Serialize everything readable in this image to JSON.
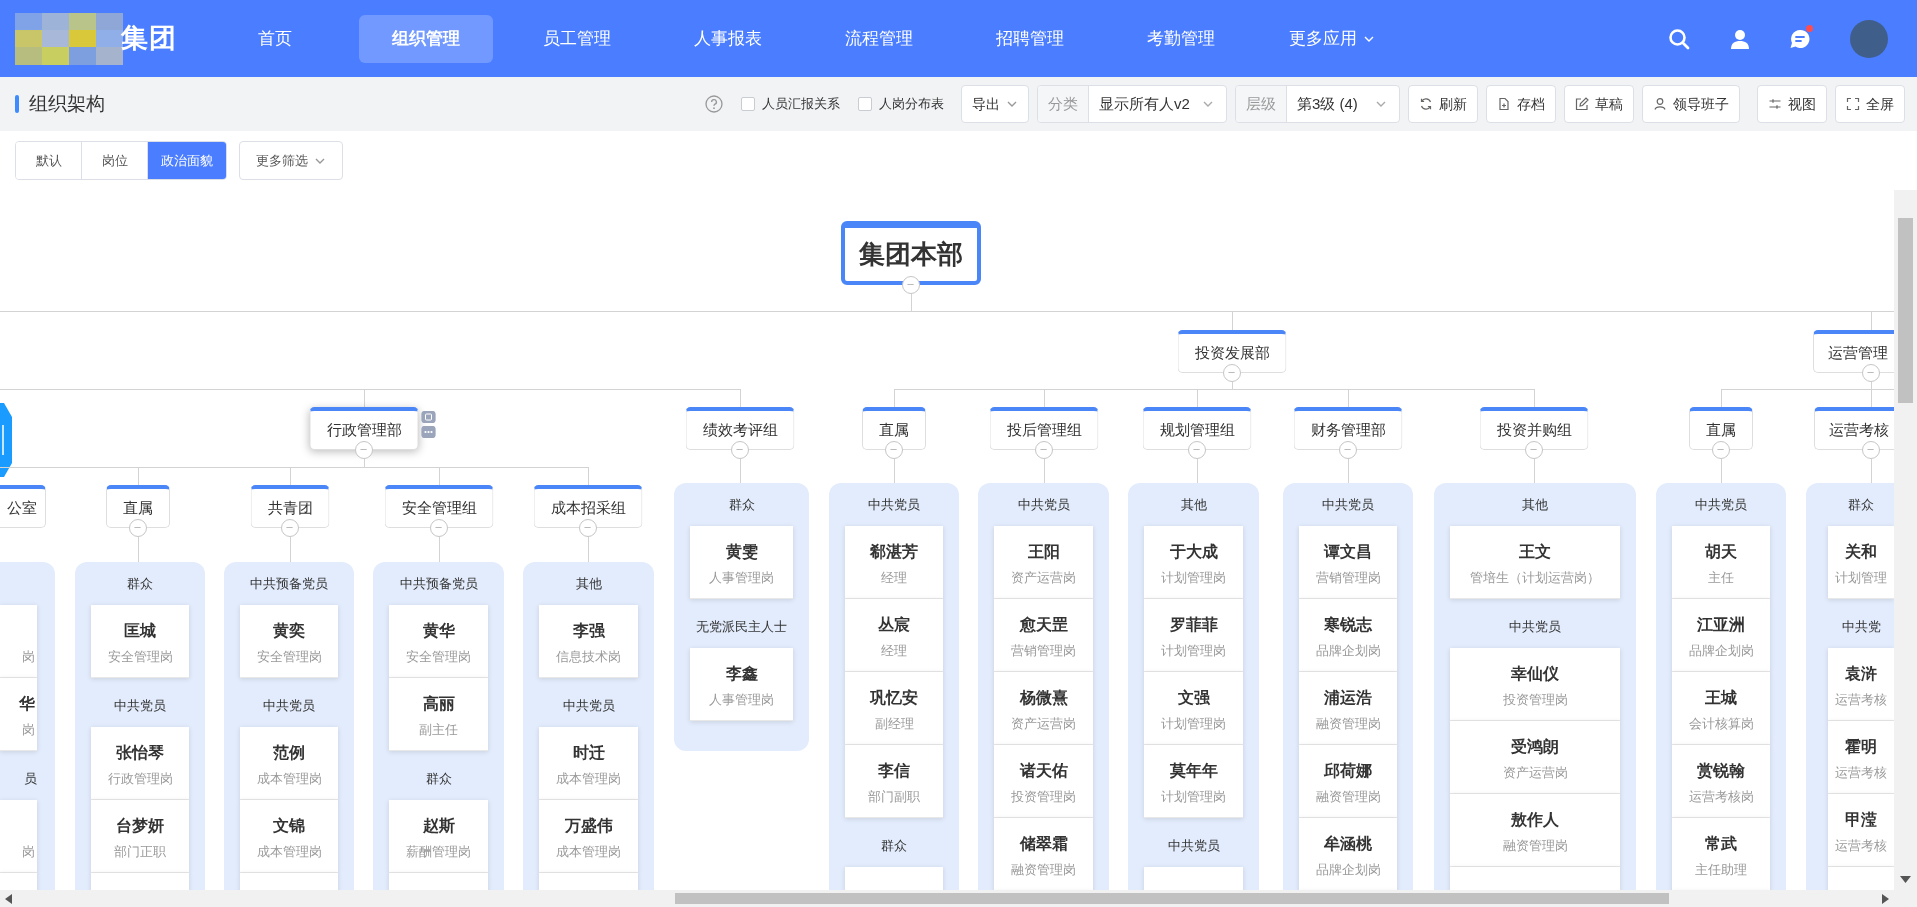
{
  "nav": {
    "brand": "集团",
    "items": [
      {
        "label": "首页",
        "selected": false
      },
      {
        "label": "组织管理",
        "selected": true
      },
      {
        "label": "员工管理",
        "selected": false
      },
      {
        "label": "人事报表",
        "selected": false
      },
      {
        "label": "流程管理",
        "selected": false
      },
      {
        "label": "招聘管理",
        "selected": false
      },
      {
        "label": "考勤管理",
        "selected": false
      }
    ],
    "more": "更多应用",
    "unread": true
  },
  "toolbar": {
    "title": "组织架构",
    "checkboxes": [
      {
        "label": "人员汇报关系",
        "checked": false
      },
      {
        "label": "人岗分布表",
        "checked": false
      }
    ],
    "export": "导出",
    "selects": [
      {
        "label": "分类",
        "value": "显示所有人v2"
      },
      {
        "label": "层级",
        "value": "第3级 (4)"
      }
    ],
    "buttons": [
      "刷新",
      "存档",
      "草稿",
      "领导班子",
      "视图",
      "全屏"
    ]
  },
  "filters": {
    "tabs": [
      {
        "label": "默认",
        "selected": false
      },
      {
        "label": "岗位",
        "selected": false
      },
      {
        "label": "政治面貌",
        "selected": true
      }
    ],
    "more": "更多筛选"
  },
  "chart": {
    "root": {
      "name": "集团本部"
    },
    "branches": [
      {
        "children": [
          {
            "name": "行政管理部",
            "selected": true,
            "children": [
              {
                "name": "公室",
                "selected": false,
                "panel": {
                  "cut_off": true,
                  "groups": [
                    {
                      "members": [
                        {
                          "role": "岗"
                        },
                        {
                          "name": "华",
                          "role": "岗"
                        }
                      ]
                    },
                    {
                      "label": "员",
                      "members": [
                        {
                          "role": "岗"
                        }
                      ]
                    }
                  ]
                }
              },
              {
                "name": "直属",
                "selected": false,
                "panel": {
                  "cut_off": true,
                  "groups": [
                    {
                      "label": "群众",
                      "members": [
                        {
                          "name": "匡城",
                          "role": "安全管理岗"
                        }
                      ]
                    },
                    {
                      "label": "中共党员",
                      "members": [
                        {
                          "name": "张怡琴",
                          "role": "行政管理岗"
                        },
                        {
                          "name": "台梦妍",
                          "role": "部门正职"
                        }
                      ]
                    }
                  ]
                }
              },
              {
                "name": "共青团",
                "selected": false,
                "panel": {
                  "cut_off": true,
                  "groups": [
                    {
                      "label": "中共预备党员",
                      "members": [
                        {
                          "name": "黄奕",
                          "role": "安全管理岗"
                        }
                      ]
                    },
                    {
                      "label": "中共党员",
                      "members": [
                        {
                          "name": "范例",
                          "role": "成本管理岗"
                        },
                        {
                          "name": "文锦",
                          "role": "成本管理岗"
                        }
                      ]
                    }
                  ]
                }
              },
              {
                "name": "安全管理组",
                "selected": false,
                "panel": {
                  "cut_off": true,
                  "groups": [
                    {
                      "label": "中共预备党员",
                      "members": [
                        {
                          "name": "黄华",
                          "role": "安全管理岗"
                        },
                        {
                          "name": "高丽",
                          "role": "副主任"
                        }
                      ]
                    },
                    {
                      "label": "群众",
                      "members": [
                        {
                          "name": "赵斯",
                          "role": "薪酬管理岗"
                        }
                      ]
                    }
                  ]
                }
              },
              {
                "name": "成本招采组",
                "selected": false,
                "panel": {
                  "cut_off": true,
                  "groups": [
                    {
                      "label": "其他",
                      "members": [
                        {
                          "name": "李强",
                          "role": "信息技术岗"
                        }
                      ]
                    },
                    {
                      "label": "中共党员",
                      "members": [
                        {
                          "name": "时迁",
                          "role": "成本管理岗"
                        },
                        {
                          "name": "万盛伟",
                          "role": "成本管理岗"
                        }
                      ]
                    }
                  ]
                }
              }
            ]
          },
          {
            "name": "绩效考评组",
            "selected": false,
            "panel": {
              "groups": [
                {
                  "label": "群众",
                  "members": [
                    {
                      "name": "黄雯",
                      "role": "人事管理岗"
                    }
                  ]
                },
                {
                  "label": "无党派民主人士",
                  "members": [
                    {
                      "name": "李鑫",
                      "role": "人事管理岗"
                    }
                  ]
                }
              ]
            }
          }
        ]
      },
      {
        "name": "投资发展部",
        "selected": false,
        "children": [
          {
            "name": "直属",
            "selected": false,
            "panel": {
              "cut_off": true,
              "groups": [
                {
                  "label": "中共党员",
                  "members": [
                    {
                      "name": "郗湛芳",
                      "role": "经理"
                    },
                    {
                      "name": "丛宸",
                      "role": "经理"
                    },
                    {
                      "name": "巩忆安",
                      "role": "副经理"
                    },
                    {
                      "name": "李信",
                      "role": "部门副职"
                    }
                  ]
                },
                {
                  "label": "群众"
                }
              ]
            }
          },
          {
            "name": "投后管理组",
            "selected": false,
            "panel": {
              "cut_off": true,
              "groups": [
                {
                  "label": "中共党员",
                  "members": [
                    {
                      "name": "王阳",
                      "role": "资产运营岗"
                    },
                    {
                      "name": "愈天罡",
                      "role": "营销管理岗"
                    },
                    {
                      "name": "杨微熹",
                      "role": "资产运营岗"
                    },
                    {
                      "name": "诸天佑",
                      "role": "投资管理岗"
                    },
                    {
                      "name": "储翠霜",
                      "role": "融资管理岗"
                    }
                  ]
                }
              ]
            }
          },
          {
            "name": "规划管理组",
            "selected": false,
            "panel": {
              "cut_off": true,
              "groups": [
                {
                  "label": "其他",
                  "members": [
                    {
                      "name": "于大成",
                      "role": "计划管理岗"
                    },
                    {
                      "name": "罗菲菲",
                      "role": "计划管理岗"
                    },
                    {
                      "name": "文强",
                      "role": "计划管理岗"
                    },
                    {
                      "name": "莫年年",
                      "role": "计划管理岗"
                    }
                  ]
                },
                {
                  "label": "中共党员"
                }
              ]
            }
          },
          {
            "name": "财务管理部",
            "selected": false,
            "panel": {
              "cut_off": true,
              "groups": [
                {
                  "label": "中共党员",
                  "members": [
                    {
                      "name": "谭文昌",
                      "role": "营销管理岗"
                    },
                    {
                      "name": "寒锐志",
                      "role": "品牌企划岗"
                    },
                    {
                      "name": "浦运浩",
                      "role": "融资管理岗"
                    },
                    {
                      "name": "邱荷娜",
                      "role": "融资管理岗"
                    },
                    {
                      "name": "牟涵桃",
                      "role": "品牌企划岗"
                    }
                  ]
                }
              ]
            }
          },
          {
            "name": "投资并购组",
            "selected": false,
            "panel": {
              "cut_off": true,
              "groups": [
                {
                  "label": "其他",
                  "members": [
                    {
                      "name": "王文",
                      "role": "管培生（计划运营岗）"
                    }
                  ]
                },
                {
                  "label": "中共党员",
                  "members": [
                    {
                      "name": "幸仙仪",
                      "role": "投资管理岗"
                    },
                    {
                      "name": "受鸿朗",
                      "role": "资产运营岗"
                    },
                    {
                      "name": "敖作人",
                      "role": "融资管理岗"
                    }
                  ]
                }
              ]
            }
          }
        ]
      },
      {
        "name": "运营管理",
        "selected": false,
        "children": [
          {
            "name": "直属",
            "selected": false,
            "panel": {
              "cut_off": true,
              "groups": [
                {
                  "label": "中共党员",
                  "members": [
                    {
                      "name": "胡天",
                      "role": "主任"
                    },
                    {
                      "name": "江亚洲",
                      "role": "品牌企划岗"
                    },
                    {
                      "name": "王城",
                      "role": "会计核算岗"
                    },
                    {
                      "name": "赏锐翰",
                      "role": "运营考核岗"
                    },
                    {
                      "name": "常武",
                      "role": "主任助理"
                    }
                  ]
                }
              ]
            }
          },
          {
            "name": "运营考核",
            "selected": false,
            "panel": {
              "cut_off": true,
              "groups": [
                {
                  "label": "群众",
                  "members": [
                    {
                      "name": "关和",
                      "role": "计划管理"
                    }
                  ]
                },
                {
                  "label": "中共党",
                  "members": [
                    {
                      "name": "袁浒",
                      "role": "运营考核"
                    },
                    {
                      "name": "霍明",
                      "role": "运营考核"
                    },
                    {
                      "name": "甲滢",
                      "role": "运营考核"
                    }
                  ]
                }
              ]
            }
          }
        ]
      }
    ]
  }
}
